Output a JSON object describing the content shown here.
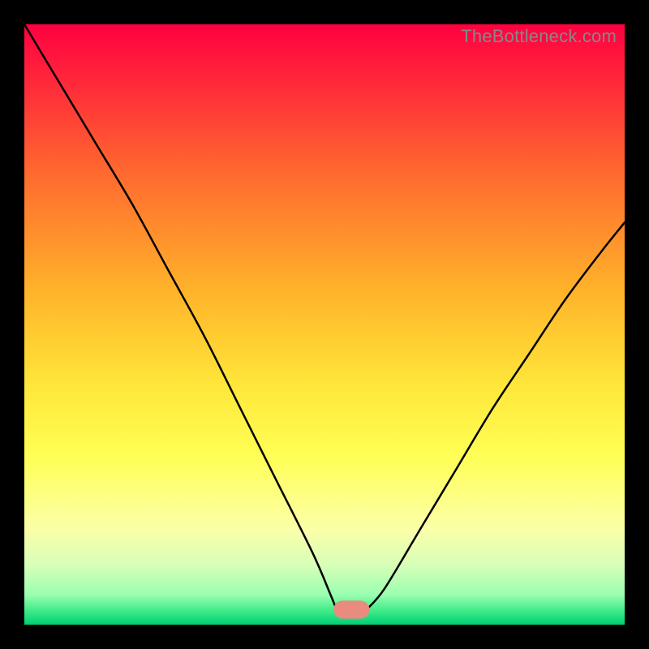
{
  "watermark": "TheBottleneck.com",
  "chart_data": {
    "type": "line",
    "title": "",
    "xlabel": "",
    "ylabel": "",
    "xlim": [
      0,
      100
    ],
    "ylim": [
      0,
      100
    ],
    "gradient_stops": [
      {
        "pct": 0,
        "color": "#ff0040"
      },
      {
        "pct": 10,
        "color": "#ff2a3a"
      },
      {
        "pct": 25,
        "color": "#ff6a2f"
      },
      {
        "pct": 45,
        "color": "#ffb52a"
      },
      {
        "pct": 60,
        "color": "#ffe63a"
      },
      {
        "pct": 72,
        "color": "#ffff55"
      },
      {
        "pct": 84,
        "color": "#fbffa8"
      },
      {
        "pct": 90,
        "color": "#d8ffb8"
      },
      {
        "pct": 95,
        "color": "#9affb0"
      },
      {
        "pct": 98,
        "color": "#35e884"
      },
      {
        "pct": 100,
        "color": "#00d074"
      }
    ],
    "series": [
      {
        "name": "bottleneck-curve",
        "color": "#000000",
        "plateau": {
          "x0": 52,
          "x1": 57,
          "y": 2.5
        },
        "left_points": [
          {
            "x": 0,
            "y": 100
          },
          {
            "x": 6,
            "y": 90
          },
          {
            "x": 12,
            "y": 80
          },
          {
            "x": 18,
            "y": 70
          },
          {
            "x": 24,
            "y": 59
          },
          {
            "x": 30,
            "y": 48
          },
          {
            "x": 36,
            "y": 36
          },
          {
            "x": 42,
            "y": 24
          },
          {
            "x": 48,
            "y": 12
          },
          {
            "x": 51,
            "y": 5
          },
          {
            "x": 52,
            "y": 2.5
          }
        ],
        "right_points": [
          {
            "x": 57,
            "y": 2.5
          },
          {
            "x": 60,
            "y": 6
          },
          {
            "x": 66,
            "y": 16
          },
          {
            "x": 72,
            "y": 26
          },
          {
            "x": 78,
            "y": 36
          },
          {
            "x": 84,
            "y": 45
          },
          {
            "x": 90,
            "y": 54
          },
          {
            "x": 96,
            "y": 62
          },
          {
            "x": 100,
            "y": 67
          }
        ]
      }
    ],
    "marker": {
      "shape": "rounded-rect",
      "x_center": 54.5,
      "y_center": 2.5,
      "width": 6,
      "height": 3,
      "color": "#e98b7e"
    }
  }
}
